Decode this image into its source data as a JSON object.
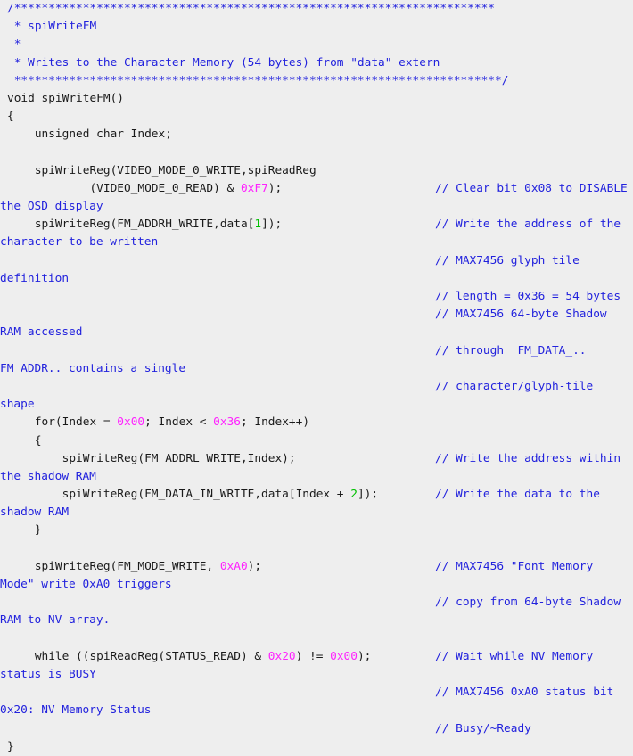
{
  "view": {
    "name": "source-code-listing",
    "language": "c",
    "background_color": "#eeeeee",
    "colors": {
      "code": "#1a1a1a",
      "comment": "#2222dd",
      "hex_literal": "#ff22ff",
      "number_literal": "#00c000"
    }
  },
  "lines": [
    {
      "code": "/**********************************************************************",
      "comment": "",
      "wrap": ""
    },
    {
      "code": " * spiWriteFM",
      "comment": "",
      "wrap": ""
    },
    {
      "code": " *",
      "comment": "",
      "wrap": ""
    },
    {
      "code": " * Writes to the Character Memory (54 bytes) from \"data\" extern",
      "comment": "",
      "wrap": ""
    },
    {
      "code": " ***********************************************************************/",
      "comment": "",
      "wrap": ""
    },
    {
      "code": "void spiWriteFM()",
      "comment": "",
      "wrap": ""
    },
    {
      "code": "{",
      "comment": "",
      "wrap": ""
    },
    {
      "code": "    unsigned char Index;",
      "comment": "",
      "wrap": ""
    },
    {
      "code": "",
      "comment": "",
      "wrap": ""
    },
    {
      "code": "    spiWriteReg(VIDEO_MODE_0_WRITE,spiReadReg",
      "comment": "",
      "wrap": ""
    },
    {
      "code": "            (VIDEO_MODE_0_READ) & 0xF7);",
      "comment": "// Clear bit 0x08 to DISABLE",
      "wrap": "the OSD display"
    },
    {
      "code": "    spiWriteReg(FM_ADDRH_WRITE,data[1]);",
      "comment": "// Write the address of the",
      "wrap": "character to be written"
    },
    {
      "code": "",
      "comment": "// MAX7456 glyph tile",
      "wrap": "definition"
    },
    {
      "code": "",
      "comment": "// length = 0x36 = 54 bytes",
      "wrap": ""
    },
    {
      "code": "",
      "comment": "// MAX7456 64-byte Shadow",
      "wrap": "RAM accessed"
    },
    {
      "code": "",
      "comment": "// through  FM_DATA_..",
      "wrap": "FM_ADDR.. contains a single"
    },
    {
      "code": "",
      "comment": "// character/glyph-tile",
      "wrap": "shape"
    },
    {
      "code": "    for(Index = 0x00; Index < 0x36; Index++)",
      "comment": "",
      "wrap": ""
    },
    {
      "code": "    {",
      "comment": "",
      "wrap": ""
    },
    {
      "code": "        spiWriteReg(FM_ADDRL_WRITE,Index);",
      "comment": "// Write the address within",
      "wrap": "the shadow RAM"
    },
    {
      "code": "        spiWriteReg(FM_DATA_IN_WRITE,data[Index + 2]);",
      "comment": "// Write the data to the",
      "wrap": "shadow RAM"
    },
    {
      "code": "    }",
      "comment": "",
      "wrap": ""
    },
    {
      "code": "",
      "comment": "",
      "wrap": ""
    },
    {
      "code": "    spiWriteReg(FM_MODE_WRITE, 0xA0);",
      "comment": "// MAX7456 \"Font Memory",
      "wrap": "Mode\" write 0xA0 triggers"
    },
    {
      "code": "",
      "comment": "// copy from 64-byte Shadow",
      "wrap": "RAM to NV array."
    },
    {
      "code": "",
      "comment": "",
      "wrap": ""
    },
    {
      "code": "    while ((spiReadReg(STATUS_READ) & 0x20) != 0x00);",
      "comment": "// Wait while NV Memory",
      "wrap": "status is BUSY"
    },
    {
      "code": "",
      "comment": "// MAX7456 0xA0 status bit",
      "wrap": "0x20: NV Memory Status"
    },
    {
      "code": "",
      "comment": "// Busy/~Ready",
      "wrap": ""
    },
    {
      "code": "}",
      "comment": "",
      "wrap": ""
    }
  ]
}
